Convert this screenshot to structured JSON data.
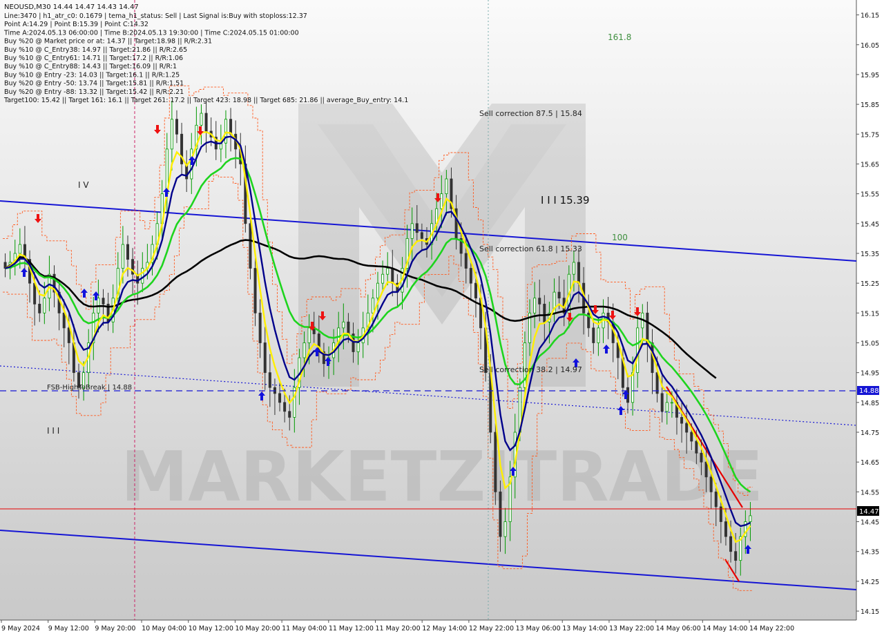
{
  "chart_data": {
    "type": "candlestick",
    "symbol_line": "NEOUSD,M30  14.44 14.47 14.43 14.47",
    "info_lines": [
      "Line:3470  |  h1_atr_c0: 0.1679  |  tema_h1_status: Sell  |  Last Signal is:Buy with stoploss:12.37",
      "Point A:14.29  |  Point B:15.39  |  Point C:14.32",
      "Time A:2024.05.13 06:00:00  |  Time B:2024.05.13 19:30:00  |  Time C:2024.05.15 01:00:00",
      "Buy %20 @ Market price or at: 14.37  ||  Target:18.98  ||  R/R:2.31",
      "Buy %10 @ C_Entry38: 14.97  ||  Target:21.86  ||  R/R:2.65",
      "Buy %10 @ C_Entry61: 14.71  ||  Target:17.2  ||  R/R:1.06",
      "Buy %10 @ C_Entry88: 14.43  ||  Target:16.09  ||  R/R:1",
      "Buy %10 @ Entry -23: 14.03  ||  Target:16.1  ||  R/R:1.25",
      "Buy %20 @ Entry -50: 13.74  ||  Target:15.81  ||  R/R:1.51",
      "Buy %20 @ Entry -88: 13.32  ||  Target:15.42  ||  R/R:2.21",
      "Target100: 15.42  ||  Target 161: 16.1  ||  Target 261: 17.2  ||  Target 423: 18.98  ||  Target 685: 21.86  ||  average_Buy_entry: 14.1"
    ],
    "annotations": {
      "fib_1618": "161.8",
      "fib_100": "100",
      "sell_875": "Sell correction 87.5 | 15.84",
      "sell_618": "Sell correction 61.8 | 15.33",
      "sell_382": "Sell correction 38.2 | 14.97",
      "big_level": "I I I 15.39",
      "fsb": "FSB-HighToBreak  |  14.88",
      "marks_left": "I V",
      "marks_bottom": "I I I"
    },
    "watermark": "MARKETZITRADE",
    "current_price_label": "14.47",
    "fsb_price_label": "14.88",
    "yaxis": {
      "range": [
        14.12,
        16.2
      ],
      "ticks": [
        "16.15",
        "16.05",
        "15.95",
        "15.85",
        "15.75",
        "15.65",
        "15.55",
        "15.45",
        "15.35",
        "15.25",
        "15.15",
        "15.05",
        "14.95",
        "14.85",
        "14.75",
        "14.65",
        "14.55",
        "14.45",
        "14.35",
        "14.25",
        "14.15"
      ]
    },
    "xaxis": {
      "ticks": [
        "9 May 2024",
        "9 May 12:00",
        "9 May 20:00",
        "10 May 04:00",
        "10 May 12:00",
        "10 May 20:00",
        "11 May 04:00",
        "11 May 12:00",
        "11 May 20:00",
        "12 May 14:00",
        "12 May 22:00",
        "13 May 06:00",
        "13 May 14:00",
        "13 May 22:00",
        "14 May 06:00",
        "14 May 14:00",
        "14 May 22:00"
      ]
    },
    "close_series": [
      15.3,
      15.32,
      15.35,
      15.38,
      15.33,
      15.25,
      15.18,
      15.15,
      15.2,
      15.28,
      15.22,
      15.15,
      15.1,
      15.05,
      14.95,
      14.9,
      14.95,
      15.05,
      15.15,
      15.2,
      15.18,
      15.12,
      15.2,
      15.3,
      15.38,
      15.33,
      15.28,
      15.25,
      15.3,
      15.32,
      15.38,
      15.45,
      15.55,
      15.7,
      15.8,
      15.75,
      15.65,
      15.6,
      15.7,
      15.78,
      15.82,
      15.76,
      15.74,
      15.7,
      15.72,
      15.8,
      15.75,
      15.7,
      15.65,
      15.45,
      15.3,
      15.15,
      15.05,
      14.95,
      14.9,
      14.88,
      14.85,
      14.82,
      14.8,
      14.9,
      15.0,
      15.05,
      15.1,
      15.08,
      15.02,
      14.98,
      15.0,
      15.05,
      15.1,
      15.12,
      15.08,
      15.02,
      15.05,
      15.1,
      15.15,
      15.2,
      15.25,
      15.28,
      15.3,
      15.25,
      15.22,
      15.3,
      15.4,
      15.45,
      15.42,
      15.4,
      15.38,
      15.45,
      15.5,
      15.55,
      15.6,
      15.5,
      15.4,
      15.35,
      15.3,
      15.25,
      15.2,
      15.1,
      14.95,
      14.75,
      14.55,
      14.4,
      14.45,
      14.6,
      14.75,
      14.9,
      15.05,
      15.15,
      15.2,
      15.18,
      15.12,
      15.15,
      15.22,
      15.2,
      15.15,
      15.28,
      15.32,
      15.25,
      15.15,
      15.1,
      15.05,
      15.1,
      15.15,
      15.12,
      15.05,
      15.0,
      14.9,
      14.85,
      14.95,
      15.1,
      15.15,
      15.05,
      14.95,
      14.88,
      14.82,
      14.85,
      14.85,
      14.8,
      14.78,
      14.75,
      14.72,
      14.68,
      14.65,
      14.6,
      14.55,
      14.5,
      14.45,
      14.4,
      14.35,
      14.32,
      14.4,
      14.45,
      14.47
    ],
    "colors": {
      "up": "#009900",
      "down": "#333333",
      "ema_black": "#000000",
      "ema_navy": "#00008B",
      "ema_yellow": "#FFEF00",
      "ema_green": "#1ED41E",
      "channel": "#1515D4",
      "bands": "#FF5A1E",
      "current": "#E60000",
      "fsb": "#1515D4"
    }
  }
}
